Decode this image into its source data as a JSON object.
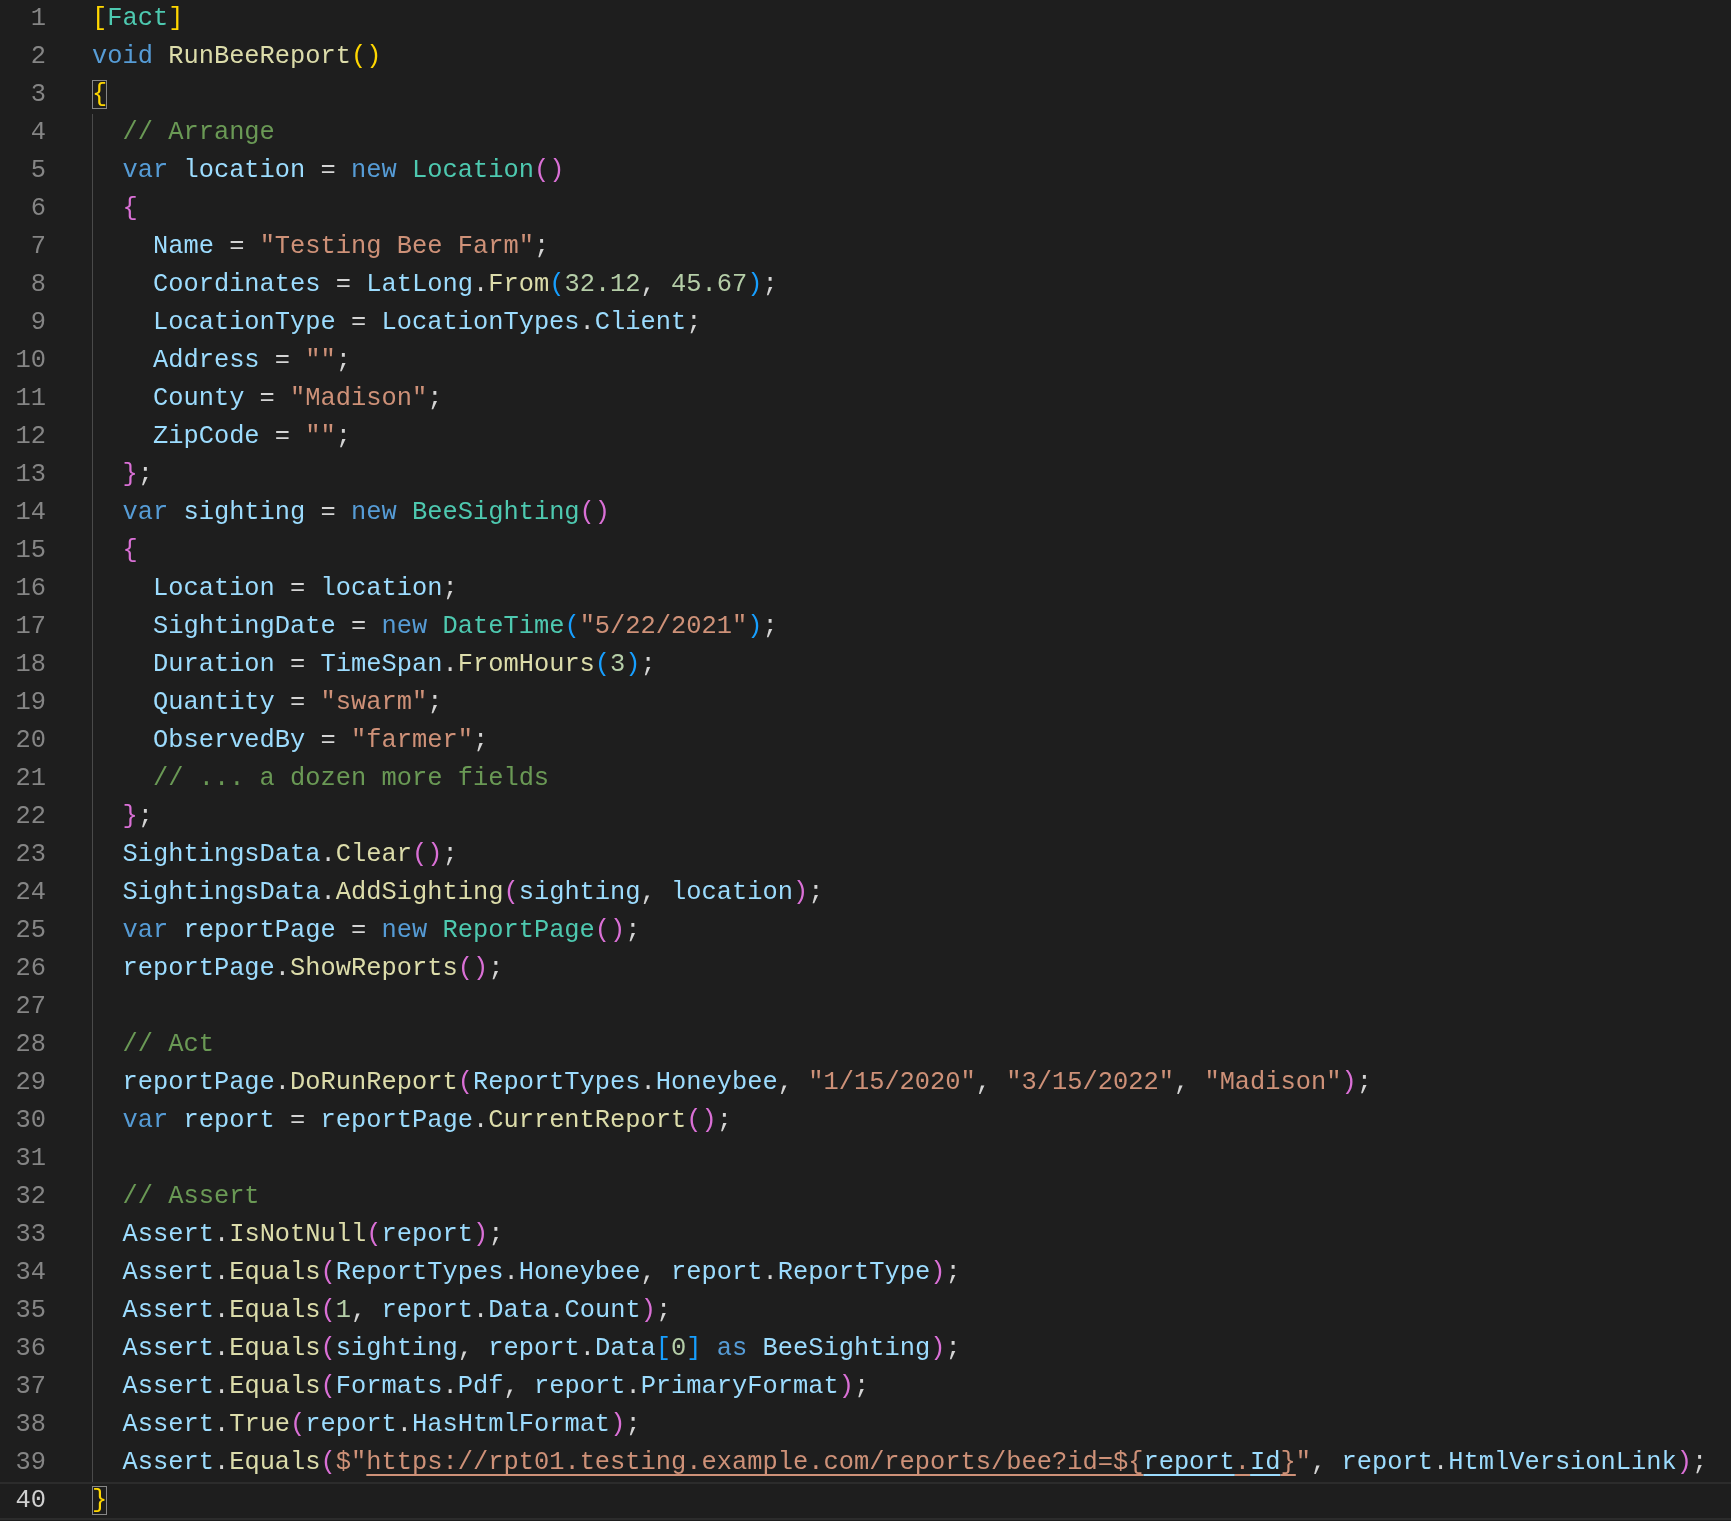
{
  "editor": {
    "lines": [
      {
        "number": "1",
        "current": false,
        "tokens": [
          {
            "kind": "b1",
            "text": "["
          },
          {
            "kind": "type",
            "text": "Fact"
          },
          {
            "kind": "b1",
            "text": "]"
          }
        ]
      },
      {
        "number": "2",
        "current": false,
        "tokens": [
          {
            "kind": "kw",
            "text": "void "
          },
          {
            "kind": "fn",
            "text": "RunBeeReport"
          },
          {
            "kind": "b1",
            "text": "()"
          }
        ]
      },
      {
        "number": "3",
        "current": false,
        "tokens": [
          {
            "kind": "b1m",
            "text": "{"
          }
        ]
      },
      {
        "number": "4",
        "current": false,
        "tokens": [
          {
            "kind": "cmt",
            "text": "  // Arrange"
          }
        ]
      },
      {
        "number": "5",
        "current": false,
        "tokens": [
          {
            "kind": "kw",
            "text": "  var "
          },
          {
            "kind": "var",
            "text": "location"
          },
          {
            "kind": "p",
            "text": " = "
          },
          {
            "kind": "kw",
            "text": "new "
          },
          {
            "kind": "type",
            "text": "Location"
          },
          {
            "kind": "b2",
            "text": "()"
          }
        ]
      },
      {
        "number": "6",
        "current": false,
        "tokens": [
          {
            "kind": "b2",
            "text": "  {"
          }
        ]
      },
      {
        "number": "7",
        "current": false,
        "tokens": [
          {
            "kind": "var",
            "text": "    Name"
          },
          {
            "kind": "p",
            "text": " = "
          },
          {
            "kind": "str",
            "text": "\"Testing Bee Farm\""
          },
          {
            "kind": "p",
            "text": ";"
          }
        ]
      },
      {
        "number": "8",
        "current": false,
        "tokens": [
          {
            "kind": "var",
            "text": "    Coordinates"
          },
          {
            "kind": "p",
            "text": " = "
          },
          {
            "kind": "var",
            "text": "LatLong"
          },
          {
            "kind": "p",
            "text": "."
          },
          {
            "kind": "fn",
            "text": "From"
          },
          {
            "kind": "b3",
            "text": "("
          },
          {
            "kind": "num",
            "text": "32.12"
          },
          {
            "kind": "p",
            "text": ", "
          },
          {
            "kind": "num",
            "text": "45.67"
          },
          {
            "kind": "b3",
            "text": ")"
          },
          {
            "kind": "p",
            "text": ";"
          }
        ]
      },
      {
        "number": "9",
        "current": false,
        "tokens": [
          {
            "kind": "var",
            "text": "    LocationType"
          },
          {
            "kind": "p",
            "text": " = "
          },
          {
            "kind": "var",
            "text": "LocationTypes"
          },
          {
            "kind": "p",
            "text": "."
          },
          {
            "kind": "var",
            "text": "Client"
          },
          {
            "kind": "p",
            "text": ";"
          }
        ]
      },
      {
        "number": "10",
        "current": false,
        "tokens": [
          {
            "kind": "var",
            "text": "    Address"
          },
          {
            "kind": "p",
            "text": " = "
          },
          {
            "kind": "str",
            "text": "\"\""
          },
          {
            "kind": "p",
            "text": ";"
          }
        ]
      },
      {
        "number": "11",
        "current": false,
        "tokens": [
          {
            "kind": "var",
            "text": "    County"
          },
          {
            "kind": "p",
            "text": " = "
          },
          {
            "kind": "str",
            "text": "\"Madison\""
          },
          {
            "kind": "p",
            "text": ";"
          }
        ]
      },
      {
        "number": "12",
        "current": false,
        "tokens": [
          {
            "kind": "var",
            "text": "    ZipCode"
          },
          {
            "kind": "p",
            "text": " = "
          },
          {
            "kind": "str",
            "text": "\"\""
          },
          {
            "kind": "p",
            "text": ";"
          }
        ]
      },
      {
        "number": "13",
        "current": false,
        "tokens": [
          {
            "kind": "b2",
            "text": "  }"
          },
          {
            "kind": "p",
            "text": ";"
          }
        ]
      },
      {
        "number": "14",
        "current": false,
        "tokens": [
          {
            "kind": "kw",
            "text": "  var "
          },
          {
            "kind": "var",
            "text": "sighting"
          },
          {
            "kind": "p",
            "text": " = "
          },
          {
            "kind": "kw",
            "text": "new "
          },
          {
            "kind": "type",
            "text": "BeeSighting"
          },
          {
            "kind": "b2",
            "text": "()"
          }
        ]
      },
      {
        "number": "15",
        "current": false,
        "tokens": [
          {
            "kind": "b2",
            "text": "  {"
          }
        ]
      },
      {
        "number": "16",
        "current": false,
        "tokens": [
          {
            "kind": "var",
            "text": "    Location"
          },
          {
            "kind": "p",
            "text": " = "
          },
          {
            "kind": "var",
            "text": "location"
          },
          {
            "kind": "p",
            "text": ";"
          }
        ]
      },
      {
        "number": "17",
        "current": false,
        "tokens": [
          {
            "kind": "var",
            "text": "    SightingDate"
          },
          {
            "kind": "p",
            "text": " = "
          },
          {
            "kind": "kw",
            "text": "new "
          },
          {
            "kind": "type",
            "text": "DateTime"
          },
          {
            "kind": "b3",
            "text": "("
          },
          {
            "kind": "str",
            "text": "\"5/22/2021\""
          },
          {
            "kind": "b3",
            "text": ")"
          },
          {
            "kind": "p",
            "text": ";"
          }
        ]
      },
      {
        "number": "18",
        "current": false,
        "tokens": [
          {
            "kind": "var",
            "text": "    Duration"
          },
          {
            "kind": "p",
            "text": " = "
          },
          {
            "kind": "var",
            "text": "TimeSpan"
          },
          {
            "kind": "p",
            "text": "."
          },
          {
            "kind": "fn",
            "text": "FromHours"
          },
          {
            "kind": "b3",
            "text": "("
          },
          {
            "kind": "num",
            "text": "3"
          },
          {
            "kind": "b3",
            "text": ")"
          },
          {
            "kind": "p",
            "text": ";"
          }
        ]
      },
      {
        "number": "19",
        "current": false,
        "tokens": [
          {
            "kind": "var",
            "text": "    Quantity"
          },
          {
            "kind": "p",
            "text": " = "
          },
          {
            "kind": "str",
            "text": "\"swarm\""
          },
          {
            "kind": "p",
            "text": ";"
          }
        ]
      },
      {
        "number": "20",
        "current": false,
        "tokens": [
          {
            "kind": "var",
            "text": "    ObservedBy"
          },
          {
            "kind": "p",
            "text": " = "
          },
          {
            "kind": "str",
            "text": "\"farmer\""
          },
          {
            "kind": "p",
            "text": ";"
          }
        ]
      },
      {
        "number": "21",
        "current": false,
        "tokens": [
          {
            "kind": "cmt",
            "text": "    // ... a dozen more fields"
          }
        ]
      },
      {
        "number": "22",
        "current": false,
        "tokens": [
          {
            "kind": "b2",
            "text": "  }"
          },
          {
            "kind": "p",
            "text": ";"
          }
        ]
      },
      {
        "number": "23",
        "current": false,
        "tokens": [
          {
            "kind": "var",
            "text": "  SightingsData"
          },
          {
            "kind": "p",
            "text": "."
          },
          {
            "kind": "fn",
            "text": "Clear"
          },
          {
            "kind": "b2",
            "text": "()"
          },
          {
            "kind": "p",
            "text": ";"
          }
        ]
      },
      {
        "number": "24",
        "current": false,
        "tokens": [
          {
            "kind": "var",
            "text": "  SightingsData"
          },
          {
            "kind": "p",
            "text": "."
          },
          {
            "kind": "fn",
            "text": "AddSighting"
          },
          {
            "kind": "b2",
            "text": "("
          },
          {
            "kind": "var",
            "text": "sighting"
          },
          {
            "kind": "p",
            "text": ", "
          },
          {
            "kind": "var",
            "text": "location"
          },
          {
            "kind": "b2",
            "text": ")"
          },
          {
            "kind": "p",
            "text": ";"
          }
        ]
      },
      {
        "number": "25",
        "current": false,
        "tokens": [
          {
            "kind": "kw",
            "text": "  var "
          },
          {
            "kind": "var",
            "text": "reportPage"
          },
          {
            "kind": "p",
            "text": " = "
          },
          {
            "kind": "kw",
            "text": "new "
          },
          {
            "kind": "type",
            "text": "ReportPage"
          },
          {
            "kind": "b2",
            "text": "()"
          },
          {
            "kind": "p",
            "text": ";"
          }
        ]
      },
      {
        "number": "26",
        "current": false,
        "tokens": [
          {
            "kind": "var",
            "text": "  reportPage"
          },
          {
            "kind": "p",
            "text": "."
          },
          {
            "kind": "fn",
            "text": "ShowReports"
          },
          {
            "kind": "b2",
            "text": "()"
          },
          {
            "kind": "p",
            "text": ";"
          }
        ]
      },
      {
        "number": "27",
        "current": false
      },
      {
        "number": "28",
        "current": false,
        "tokens": [
          {
            "kind": "cmt",
            "text": "  // Act"
          }
        ]
      },
      {
        "number": "29",
        "current": false,
        "tokens": [
          {
            "kind": "var",
            "text": "  reportPage"
          },
          {
            "kind": "p",
            "text": "."
          },
          {
            "kind": "fn",
            "text": "DoRunReport"
          },
          {
            "kind": "b2",
            "text": "("
          },
          {
            "kind": "var",
            "text": "ReportTypes"
          },
          {
            "kind": "p",
            "text": "."
          },
          {
            "kind": "var",
            "text": "Honeybee"
          },
          {
            "kind": "p",
            "text": ", "
          },
          {
            "kind": "str",
            "text": "\"1/15/2020\""
          },
          {
            "kind": "p",
            "text": ", "
          },
          {
            "kind": "str",
            "text": "\"3/15/2022\""
          },
          {
            "kind": "p",
            "text": ", "
          },
          {
            "kind": "str",
            "text": "\"Madison\""
          },
          {
            "kind": "b2",
            "text": ")"
          },
          {
            "kind": "p",
            "text": ";"
          }
        ]
      },
      {
        "number": "30",
        "current": false,
        "tokens": [
          {
            "kind": "kw",
            "text": "  var "
          },
          {
            "kind": "var",
            "text": "report"
          },
          {
            "kind": "p",
            "text": " = "
          },
          {
            "kind": "var",
            "text": "reportPage"
          },
          {
            "kind": "p",
            "text": "."
          },
          {
            "kind": "fn",
            "text": "CurrentReport"
          },
          {
            "kind": "b2",
            "text": "()"
          },
          {
            "kind": "p",
            "text": ";"
          }
        ]
      },
      {
        "number": "31",
        "current": false
      },
      {
        "number": "32",
        "current": false,
        "tokens": [
          {
            "kind": "cmt",
            "text": "  // Assert"
          }
        ]
      },
      {
        "number": "33",
        "current": false,
        "tokens": [
          {
            "kind": "var",
            "text": "  Assert"
          },
          {
            "kind": "p",
            "text": "."
          },
          {
            "kind": "fn",
            "text": "IsNotNull"
          },
          {
            "kind": "b2",
            "text": "("
          },
          {
            "kind": "var",
            "text": "report"
          },
          {
            "kind": "b2",
            "text": ")"
          },
          {
            "kind": "p",
            "text": ";"
          }
        ]
      },
      {
        "number": "34",
        "current": false,
        "tokens": [
          {
            "kind": "var",
            "text": "  Assert"
          },
          {
            "kind": "p",
            "text": "."
          },
          {
            "kind": "fn",
            "text": "Equals"
          },
          {
            "kind": "b2",
            "text": "("
          },
          {
            "kind": "var",
            "text": "ReportTypes"
          },
          {
            "kind": "p",
            "text": "."
          },
          {
            "kind": "var",
            "text": "Honeybee"
          },
          {
            "kind": "p",
            "text": ", "
          },
          {
            "kind": "var",
            "text": "report"
          },
          {
            "kind": "p",
            "text": "."
          },
          {
            "kind": "var",
            "text": "ReportType"
          },
          {
            "kind": "b2",
            "text": ")"
          },
          {
            "kind": "p",
            "text": ";"
          }
        ]
      },
      {
        "number": "35",
        "current": false,
        "tokens": [
          {
            "kind": "var",
            "text": "  Assert"
          },
          {
            "kind": "p",
            "text": "."
          },
          {
            "kind": "fn",
            "text": "Equals"
          },
          {
            "kind": "b2",
            "text": "("
          },
          {
            "kind": "num",
            "text": "1"
          },
          {
            "kind": "p",
            "text": ", "
          },
          {
            "kind": "var",
            "text": "report"
          },
          {
            "kind": "p",
            "text": "."
          },
          {
            "kind": "var",
            "text": "Data"
          },
          {
            "kind": "p",
            "text": "."
          },
          {
            "kind": "var",
            "text": "Count"
          },
          {
            "kind": "b2",
            "text": ")"
          },
          {
            "kind": "p",
            "text": ";"
          }
        ]
      },
      {
        "number": "36",
        "current": false,
        "tokens": [
          {
            "kind": "var",
            "text": "  Assert"
          },
          {
            "kind": "p",
            "text": "."
          },
          {
            "kind": "fn",
            "text": "Equals"
          },
          {
            "kind": "b2",
            "text": "("
          },
          {
            "kind": "var",
            "text": "sighting"
          },
          {
            "kind": "p",
            "text": ", "
          },
          {
            "kind": "var",
            "text": "report"
          },
          {
            "kind": "p",
            "text": "."
          },
          {
            "kind": "var",
            "text": "Data"
          },
          {
            "kind": "b3",
            "text": "["
          },
          {
            "kind": "num",
            "text": "0"
          },
          {
            "kind": "b3",
            "text": "]"
          },
          {
            "kind": "kw",
            "text": " as "
          },
          {
            "kind": "var",
            "text": "BeeSighting"
          },
          {
            "kind": "b2",
            "text": ")"
          },
          {
            "kind": "p",
            "text": ";"
          }
        ]
      },
      {
        "number": "37",
        "current": false,
        "tokens": [
          {
            "kind": "var",
            "text": "  Assert"
          },
          {
            "kind": "p",
            "text": "."
          },
          {
            "kind": "fn",
            "text": "Equals"
          },
          {
            "kind": "b2",
            "text": "("
          },
          {
            "kind": "var",
            "text": "Formats"
          },
          {
            "kind": "p",
            "text": "."
          },
          {
            "kind": "var",
            "text": "Pdf"
          },
          {
            "kind": "p",
            "text": ", "
          },
          {
            "kind": "var",
            "text": "report"
          },
          {
            "kind": "p",
            "text": "."
          },
          {
            "kind": "var",
            "text": "PrimaryFormat"
          },
          {
            "kind": "b2",
            "text": ")"
          },
          {
            "kind": "p",
            "text": ";"
          }
        ]
      },
      {
        "number": "38",
        "current": false,
        "tokens": [
          {
            "kind": "var",
            "text": "  Assert"
          },
          {
            "kind": "p",
            "text": "."
          },
          {
            "kind": "fn",
            "text": "True"
          },
          {
            "kind": "b2",
            "text": "("
          },
          {
            "kind": "var",
            "text": "report"
          },
          {
            "kind": "p",
            "text": "."
          },
          {
            "kind": "var",
            "text": "HasHtmlFormat"
          },
          {
            "kind": "b2",
            "text": ")"
          },
          {
            "kind": "p",
            "text": ";"
          }
        ]
      },
      {
        "number": "39",
        "current": false,
        "tokens": [
          {
            "kind": "var",
            "text": "  Assert"
          },
          {
            "kind": "p",
            "text": "."
          },
          {
            "kind": "fn",
            "text": "Equals"
          },
          {
            "kind": "b2",
            "text": "("
          },
          {
            "kind": "str",
            "text": "$\""
          },
          {
            "kind": "url",
            "text": "https://rpt01.testing.example.com/reports/bee?id=${"
          },
          {
            "kind": "url_var",
            "text": "report"
          },
          {
            "kind": "url",
            "text": "."
          },
          {
            "kind": "url_var",
            "text": "Id"
          },
          {
            "kind": "url",
            "text": "}"
          },
          {
            "kind": "str",
            "text": "\""
          },
          {
            "kind": "p",
            "text": ", "
          },
          {
            "kind": "var",
            "text": "report"
          },
          {
            "kind": "p",
            "text": "."
          },
          {
            "kind": "var",
            "text": "HtmlVersionLink"
          },
          {
            "kind": "b2",
            "text": ")"
          },
          {
            "kind": "p",
            "text": ";"
          }
        ]
      },
      {
        "number": "40",
        "current": true,
        "tokens": [
          {
            "kind": "b1m",
            "text": "}"
          }
        ]
      }
    ]
  }
}
